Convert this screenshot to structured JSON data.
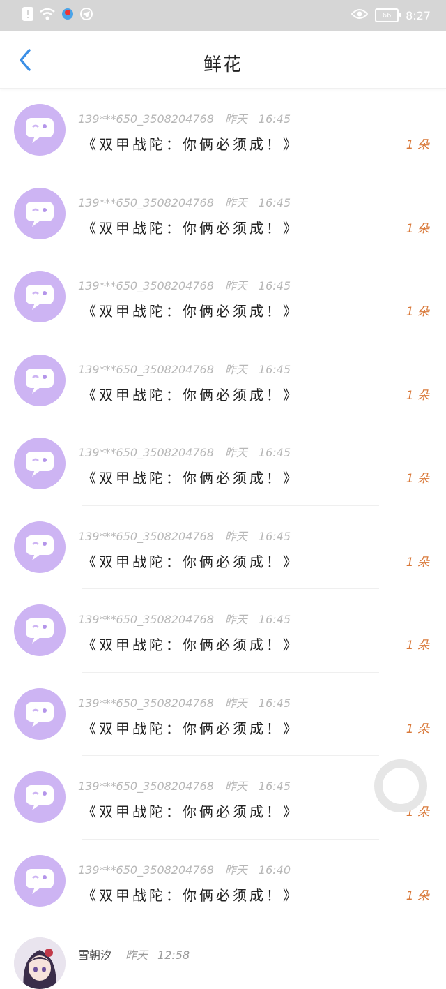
{
  "status_bar": {
    "time": "8:27",
    "battery": "66"
  },
  "header": {
    "title": "鲜花"
  },
  "colors": {
    "avatar_bg": "#cdb4f3",
    "accent_back": "#3b8fe6",
    "count_text": "#d9793a"
  },
  "items": [
    {
      "user": "139***650_3508204768",
      "day": "昨天",
      "time": "16:45",
      "message": "《双甲战陀：你俩必须成！》",
      "count": "1 朵"
    },
    {
      "user": "139***650_3508204768",
      "day": "昨天",
      "time": "16:45",
      "message": "《双甲战陀：你俩必须成！》",
      "count": "1 朵"
    },
    {
      "user": "139***650_3508204768",
      "day": "昨天",
      "time": "16:45",
      "message": "《双甲战陀：你俩必须成！》",
      "count": "1 朵"
    },
    {
      "user": "139***650_3508204768",
      "day": "昨天",
      "time": "16:45",
      "message": "《双甲战陀：你俩必须成！》",
      "count": "1 朵"
    },
    {
      "user": "139***650_3508204768",
      "day": "昨天",
      "time": "16:45",
      "message": "《双甲战陀：你俩必须成！》",
      "count": "1 朵"
    },
    {
      "user": "139***650_3508204768",
      "day": "昨天",
      "time": "16:45",
      "message": "《双甲战陀：你俩必须成！》",
      "count": "1 朵"
    },
    {
      "user": "139***650_3508204768",
      "day": "昨天",
      "time": "16:45",
      "message": "《双甲战陀：你俩必须成！》",
      "count": "1 朵"
    },
    {
      "user": "139***650_3508204768",
      "day": "昨天",
      "time": "16:45",
      "message": "《双甲战陀：你俩必须成！》",
      "count": "1 朵"
    },
    {
      "user": "139***650_3508204768",
      "day": "昨天",
      "time": "16:45",
      "message": "《双甲战陀：你俩必须成！》",
      "count": "1 朵"
    },
    {
      "user": "139***650_3508204768",
      "day": "昨天",
      "time": "16:40",
      "message": "《双甲战陀：你俩必须成！》",
      "count": "1 朵"
    }
  ],
  "last_item": {
    "user": "雪朝汐",
    "day": "昨天",
    "time": "12:58"
  }
}
